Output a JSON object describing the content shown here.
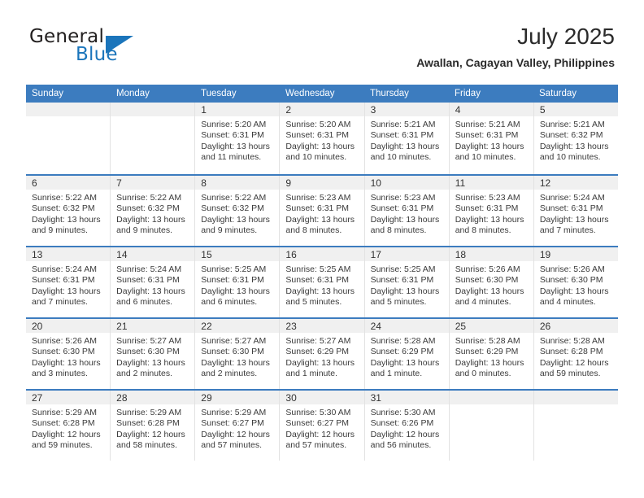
{
  "brand": {
    "name_top": "General",
    "name_bottom": "Blue",
    "accent_color": "#1b75bb",
    "triangle_icon": "triangle-icon"
  },
  "header": {
    "title": "July 2025",
    "subtitle": "Awallan, Cagayan Valley, Philippines",
    "header_bg_color": "#3c7cbf"
  },
  "calendar": {
    "weekdays": [
      "Sunday",
      "Monday",
      "Tuesday",
      "Wednesday",
      "Thursday",
      "Friday",
      "Saturday"
    ],
    "weeks": [
      [
        {
          "day": "",
          "sunrise": "",
          "sunset": "",
          "daylight_line1": "",
          "daylight_line2": "",
          "empty": true
        },
        {
          "day": "",
          "sunrise": "",
          "sunset": "",
          "daylight_line1": "",
          "daylight_line2": "",
          "empty": true
        },
        {
          "day": "1",
          "sunrise": "Sunrise: 5:20 AM",
          "sunset": "Sunset: 6:31 PM",
          "daylight_line1": "Daylight: 13 hours",
          "daylight_line2": "and 11 minutes."
        },
        {
          "day": "2",
          "sunrise": "Sunrise: 5:20 AM",
          "sunset": "Sunset: 6:31 PM",
          "daylight_line1": "Daylight: 13 hours",
          "daylight_line2": "and 10 minutes."
        },
        {
          "day": "3",
          "sunrise": "Sunrise: 5:21 AM",
          "sunset": "Sunset: 6:31 PM",
          "daylight_line1": "Daylight: 13 hours",
          "daylight_line2": "and 10 minutes."
        },
        {
          "day": "4",
          "sunrise": "Sunrise: 5:21 AM",
          "sunset": "Sunset: 6:31 PM",
          "daylight_line1": "Daylight: 13 hours",
          "daylight_line2": "and 10 minutes."
        },
        {
          "day": "5",
          "sunrise": "Sunrise: 5:21 AM",
          "sunset": "Sunset: 6:32 PM",
          "daylight_line1": "Daylight: 13 hours",
          "daylight_line2": "and 10 minutes."
        }
      ],
      [
        {
          "day": "6",
          "sunrise": "Sunrise: 5:22 AM",
          "sunset": "Sunset: 6:32 PM",
          "daylight_line1": "Daylight: 13 hours",
          "daylight_line2": "and 9 minutes."
        },
        {
          "day": "7",
          "sunrise": "Sunrise: 5:22 AM",
          "sunset": "Sunset: 6:32 PM",
          "daylight_line1": "Daylight: 13 hours",
          "daylight_line2": "and 9 minutes."
        },
        {
          "day": "8",
          "sunrise": "Sunrise: 5:22 AM",
          "sunset": "Sunset: 6:32 PM",
          "daylight_line1": "Daylight: 13 hours",
          "daylight_line2": "and 9 minutes."
        },
        {
          "day": "9",
          "sunrise": "Sunrise: 5:23 AM",
          "sunset": "Sunset: 6:31 PM",
          "daylight_line1": "Daylight: 13 hours",
          "daylight_line2": "and 8 minutes."
        },
        {
          "day": "10",
          "sunrise": "Sunrise: 5:23 AM",
          "sunset": "Sunset: 6:31 PM",
          "daylight_line1": "Daylight: 13 hours",
          "daylight_line2": "and 8 minutes."
        },
        {
          "day": "11",
          "sunrise": "Sunrise: 5:23 AM",
          "sunset": "Sunset: 6:31 PM",
          "daylight_line1": "Daylight: 13 hours",
          "daylight_line2": "and 8 minutes."
        },
        {
          "day": "12",
          "sunrise": "Sunrise: 5:24 AM",
          "sunset": "Sunset: 6:31 PM",
          "daylight_line1": "Daylight: 13 hours",
          "daylight_line2": "and 7 minutes."
        }
      ],
      [
        {
          "day": "13",
          "sunrise": "Sunrise: 5:24 AM",
          "sunset": "Sunset: 6:31 PM",
          "daylight_line1": "Daylight: 13 hours",
          "daylight_line2": "and 7 minutes."
        },
        {
          "day": "14",
          "sunrise": "Sunrise: 5:24 AM",
          "sunset": "Sunset: 6:31 PM",
          "daylight_line1": "Daylight: 13 hours",
          "daylight_line2": "and 6 minutes."
        },
        {
          "day": "15",
          "sunrise": "Sunrise: 5:25 AM",
          "sunset": "Sunset: 6:31 PM",
          "daylight_line1": "Daylight: 13 hours",
          "daylight_line2": "and 6 minutes."
        },
        {
          "day": "16",
          "sunrise": "Sunrise: 5:25 AM",
          "sunset": "Sunset: 6:31 PM",
          "daylight_line1": "Daylight: 13 hours",
          "daylight_line2": "and 5 minutes."
        },
        {
          "day": "17",
          "sunrise": "Sunrise: 5:25 AM",
          "sunset": "Sunset: 6:31 PM",
          "daylight_line1": "Daylight: 13 hours",
          "daylight_line2": "and 5 minutes."
        },
        {
          "day": "18",
          "sunrise": "Sunrise: 5:26 AM",
          "sunset": "Sunset: 6:30 PM",
          "daylight_line1": "Daylight: 13 hours",
          "daylight_line2": "and 4 minutes."
        },
        {
          "day": "19",
          "sunrise": "Sunrise: 5:26 AM",
          "sunset": "Sunset: 6:30 PM",
          "daylight_line1": "Daylight: 13 hours",
          "daylight_line2": "and 4 minutes."
        }
      ],
      [
        {
          "day": "20",
          "sunrise": "Sunrise: 5:26 AM",
          "sunset": "Sunset: 6:30 PM",
          "daylight_line1": "Daylight: 13 hours",
          "daylight_line2": "and 3 minutes."
        },
        {
          "day": "21",
          "sunrise": "Sunrise: 5:27 AM",
          "sunset": "Sunset: 6:30 PM",
          "daylight_line1": "Daylight: 13 hours",
          "daylight_line2": "and 2 minutes."
        },
        {
          "day": "22",
          "sunrise": "Sunrise: 5:27 AM",
          "sunset": "Sunset: 6:30 PM",
          "daylight_line1": "Daylight: 13 hours",
          "daylight_line2": "and 2 minutes."
        },
        {
          "day": "23",
          "sunrise": "Sunrise: 5:27 AM",
          "sunset": "Sunset: 6:29 PM",
          "daylight_line1": "Daylight: 13 hours",
          "daylight_line2": "and 1 minute."
        },
        {
          "day": "24",
          "sunrise": "Sunrise: 5:28 AM",
          "sunset": "Sunset: 6:29 PM",
          "daylight_line1": "Daylight: 13 hours",
          "daylight_line2": "and 1 minute."
        },
        {
          "day": "25",
          "sunrise": "Sunrise: 5:28 AM",
          "sunset": "Sunset: 6:29 PM",
          "daylight_line1": "Daylight: 13 hours",
          "daylight_line2": "and 0 minutes."
        },
        {
          "day": "26",
          "sunrise": "Sunrise: 5:28 AM",
          "sunset": "Sunset: 6:28 PM",
          "daylight_line1": "Daylight: 12 hours",
          "daylight_line2": "and 59 minutes."
        }
      ],
      [
        {
          "day": "27",
          "sunrise": "Sunrise: 5:29 AM",
          "sunset": "Sunset: 6:28 PM",
          "daylight_line1": "Daylight: 12 hours",
          "daylight_line2": "and 59 minutes."
        },
        {
          "day": "28",
          "sunrise": "Sunrise: 5:29 AM",
          "sunset": "Sunset: 6:28 PM",
          "daylight_line1": "Daylight: 12 hours",
          "daylight_line2": "and 58 minutes."
        },
        {
          "day": "29",
          "sunrise": "Sunrise: 5:29 AM",
          "sunset": "Sunset: 6:27 PM",
          "daylight_line1": "Daylight: 12 hours",
          "daylight_line2": "and 57 minutes."
        },
        {
          "day": "30",
          "sunrise": "Sunrise: 5:30 AM",
          "sunset": "Sunset: 6:27 PM",
          "daylight_line1": "Daylight: 12 hours",
          "daylight_line2": "and 57 minutes."
        },
        {
          "day": "31",
          "sunrise": "Sunrise: 5:30 AM",
          "sunset": "Sunset: 6:26 PM",
          "daylight_line1": "Daylight: 12 hours",
          "daylight_line2": "and 56 minutes."
        },
        {
          "day": "",
          "sunrise": "",
          "sunset": "",
          "daylight_line1": "",
          "daylight_line2": "",
          "empty": true
        },
        {
          "day": "",
          "sunrise": "",
          "sunset": "",
          "daylight_line1": "",
          "daylight_line2": "",
          "empty": true
        }
      ]
    ]
  }
}
